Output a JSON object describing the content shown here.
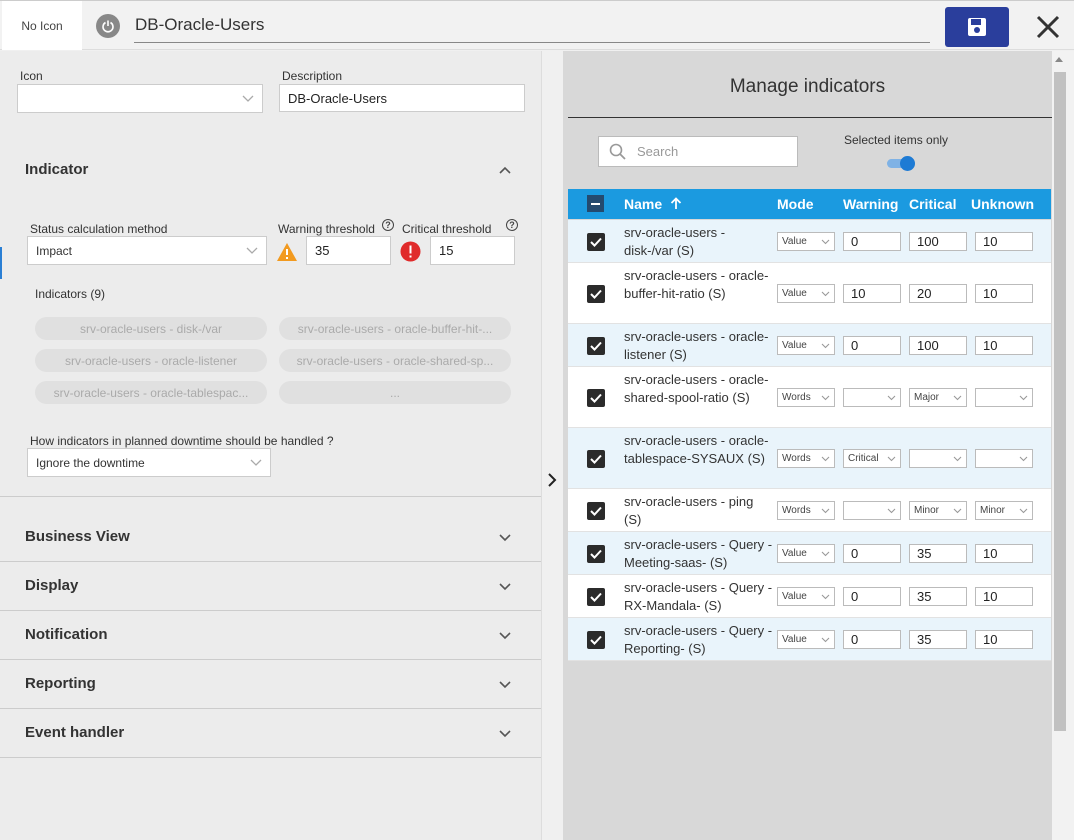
{
  "header": {
    "no_icon_label": "No Icon",
    "title": "DB-Oracle-Users"
  },
  "form": {
    "icon_label": "Icon",
    "icon_value": "",
    "description_label": "Description",
    "description_value": "DB-Oracle-Users"
  },
  "indicator_section": {
    "title": "Indicator",
    "status_method_label": "Status calculation method",
    "status_method_value": "Impact",
    "warning_threshold_label": "Warning threshold",
    "warning_threshold_value": "35",
    "critical_threshold_label": "Critical threshold",
    "critical_threshold_value": "15",
    "indicators_label": "Indicators (9)",
    "chips": [
      "srv-oracle-users - disk-/var",
      "srv-oracle-users - oracle-buffer-hit-...",
      "srv-oracle-users - oracle-listener",
      "srv-oracle-users - oracle-shared-sp...",
      "srv-oracle-users - oracle-tablespac...",
      "..."
    ],
    "downtime_label": "How indicators in planned downtime should be handled ?",
    "downtime_value": "Ignore the downtime"
  },
  "sections": [
    "Business View",
    "Display",
    "Notification",
    "Reporting",
    "Event handler"
  ],
  "manage": {
    "title": "Manage indicators",
    "search_placeholder": "Search",
    "selected_only_label": "Selected items only",
    "columns": [
      "Name",
      "Mode",
      "Warning",
      "Critical",
      "Unknown"
    ],
    "rows": [
      {
        "name": "srv-oracle-users - disk-/var (S)",
        "mode": "Value",
        "warning": "0",
        "critical": "100",
        "unknown": "10"
      },
      {
        "name": "srv-oracle-users - oracle-buffer-hit-ratio (S)",
        "mode": "Value",
        "warning": "10",
        "critical": "20",
        "unknown": "10"
      },
      {
        "name": "srv-oracle-users - oracle-listener (S)",
        "mode": "Value",
        "warning": "0",
        "critical": "100",
        "unknown": "10"
      },
      {
        "name": "srv-oracle-users - oracle-shared-spool-ratio (S)",
        "mode": "Words",
        "warning": "",
        "critical": "Major",
        "unknown": ""
      },
      {
        "name": "srv-oracle-users - oracle-tablespace-SYSAUX (S)",
        "mode": "Words",
        "warning": "Critical",
        "critical": "",
        "unknown": ""
      },
      {
        "name": "srv-oracle-users - ping (S)",
        "mode": "Words",
        "warning": "",
        "critical": "Minor",
        "unknown": "Minor"
      },
      {
        "name": "srv-oracle-users - Query -Meeting-saas- (S)",
        "mode": "Value",
        "warning": "0",
        "critical": "35",
        "unknown": "10"
      },
      {
        "name": "srv-oracle-users - Query -RX-Mandala- (S)",
        "mode": "Value",
        "warning": "0",
        "critical": "35",
        "unknown": "10"
      },
      {
        "name": "srv-oracle-users - Query -Reporting- (S)",
        "mode": "Value",
        "warning": "0",
        "critical": "35",
        "unknown": "10"
      }
    ]
  },
  "colors": {
    "accent": "#1b9ae0",
    "save": "#2a3e9c",
    "warning": "#f29a1f",
    "critical": "#e02b2b"
  }
}
